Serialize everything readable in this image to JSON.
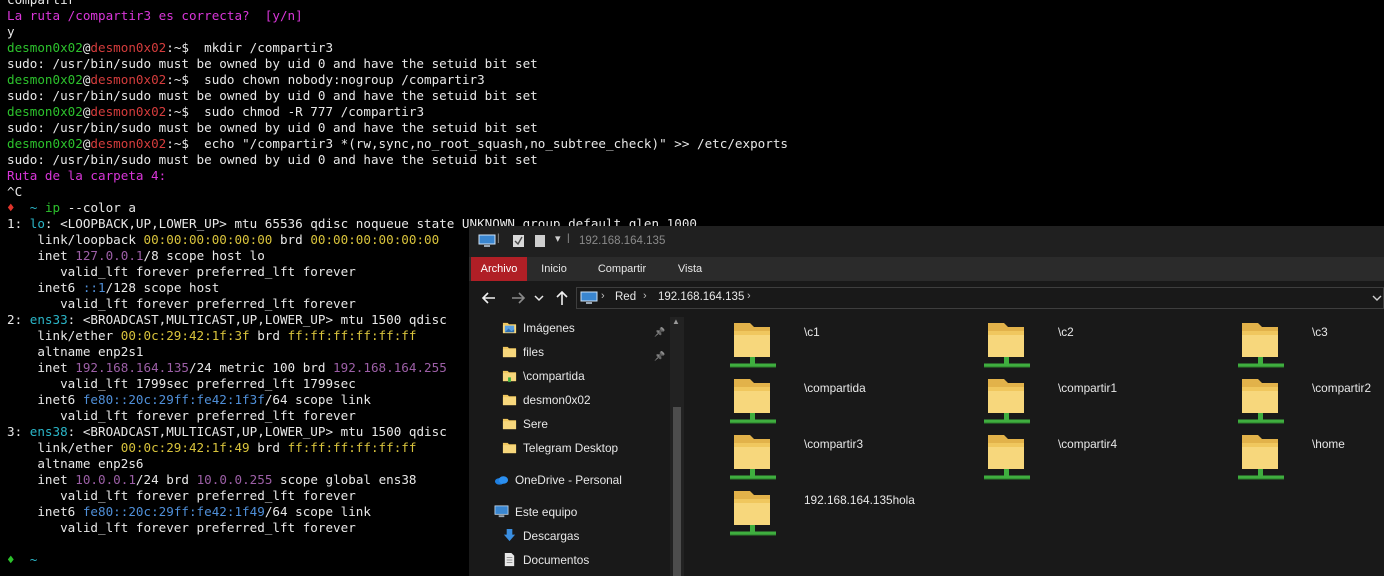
{
  "terminal": {
    "lines": [
      [
        [
          "c-plain",
          "compartir"
        ]
      ],
      [
        [
          "c-mag",
          "La ruta /compartir3 es correcta?  [y/n]"
        ]
      ],
      [
        [
          "c-plain",
          "y"
        ]
      ],
      [
        [
          "c-user",
          "desmon0x02"
        ],
        [
          "c-plain",
          "@"
        ],
        [
          "c-host",
          "desmon0x02"
        ],
        [
          "c-plain",
          ":~$  mkdir /compartir3"
        ]
      ],
      [
        [
          "c-plain",
          "sudo: /usr/bin/sudo must be owned by uid 0 and have the setuid bit set"
        ]
      ],
      [
        [
          "c-user",
          "desmon0x02"
        ],
        [
          "c-plain",
          "@"
        ],
        [
          "c-host",
          "desmon0x02"
        ],
        [
          "c-plain",
          ":~$  sudo chown nobody:nogroup /compartir3"
        ]
      ],
      [
        [
          "c-plain",
          "sudo: /usr/bin/sudo must be owned by uid 0 and have the setuid bit set"
        ]
      ],
      [
        [
          "c-user",
          "desmon0x02"
        ],
        [
          "c-plain",
          "@"
        ],
        [
          "c-host",
          "desmon0x02"
        ],
        [
          "c-plain",
          ":~$  sudo chmod -R 777 /compartir3"
        ]
      ],
      [
        [
          "c-plain",
          "sudo: /usr/bin/sudo must be owned by uid 0 and have the setuid bit set"
        ]
      ],
      [
        [
          "c-user",
          "desmon0x02"
        ],
        [
          "c-plain",
          "@"
        ],
        [
          "c-host",
          "desmon0x02"
        ],
        [
          "c-plain",
          ":~$  echo \"/compartir3 *(rw,sync,no_root_squash,no_subtree_check)\" >> /etc/exports"
        ]
      ],
      [
        [
          "c-plain",
          "sudo: /usr/bin/sudo must be owned by uid 0 and have the setuid bit set"
        ]
      ],
      [
        [
          "c-mag",
          "Ruta de la carpeta 4:"
        ]
      ],
      [
        [
          "c-plain",
          "^C"
        ]
      ],
      [
        [
          "c-red",
          "♦"
        ],
        [
          "c-plain",
          "  "
        ],
        [
          "c-cyan",
          "~"
        ],
        [
          "c-plain",
          " "
        ],
        [
          "c-green",
          "ip"
        ],
        [
          "c-plain",
          " --color a"
        ]
      ],
      [
        [
          "c-plain",
          "1: "
        ],
        [
          "c-cyan",
          "lo"
        ],
        [
          "c-plain",
          ": <LOOPBACK,UP,LOWER_UP> mtu 65536 qdisc noqueue state UNKNOWN group default qlen 1000"
        ]
      ],
      [
        [
          "c-plain",
          "    link/loopback "
        ],
        [
          "c-yellow",
          "00:00:00:00:00:00"
        ],
        [
          "c-plain",
          " brd "
        ],
        [
          "c-yellow",
          "00:00:00:00:00:00"
        ]
      ],
      [
        [
          "c-plain",
          "    inet "
        ],
        [
          "c-purple",
          "127.0.0.1"
        ],
        [
          "c-plain",
          "/8 scope host lo"
        ]
      ],
      [
        [
          "c-plain",
          "       valid_lft forever preferred_lft forever"
        ]
      ],
      [
        [
          "c-plain",
          "    inet6 "
        ],
        [
          "c-blue",
          "::1"
        ],
        [
          "c-plain",
          "/128 scope host"
        ]
      ],
      [
        [
          "c-plain",
          "       valid_lft forever preferred_lft forever"
        ]
      ],
      [
        [
          "c-plain",
          "2: "
        ],
        [
          "c-cyan",
          "ens33"
        ],
        [
          "c-plain",
          ": <BROADCAST,MULTICAST,UP,LOWER_UP> mtu 1500 qdisc"
        ]
      ],
      [
        [
          "c-plain",
          "    link/ether "
        ],
        [
          "c-yellow",
          "00:0c:29:42:1f:3f"
        ],
        [
          "c-plain",
          " brd "
        ],
        [
          "c-yellow",
          "ff:ff:ff:ff:ff:ff"
        ]
      ],
      [
        [
          "c-plain",
          "    altname enp2s1"
        ]
      ],
      [
        [
          "c-plain",
          "    inet "
        ],
        [
          "c-purple",
          "192.168.164.135"
        ],
        [
          "c-plain",
          "/24 metric 100 brd "
        ],
        [
          "c-purple",
          "192.168.164.255"
        ]
      ],
      [
        [
          "c-plain",
          "       valid_lft 1799sec preferred_lft 1799sec"
        ]
      ],
      [
        [
          "c-plain",
          "    inet6 "
        ],
        [
          "c-blue",
          "fe80::20c:29ff:fe42:1f3f"
        ],
        [
          "c-plain",
          "/64 scope link"
        ]
      ],
      [
        [
          "c-plain",
          "       valid_lft forever preferred_lft forever"
        ]
      ],
      [
        [
          "c-plain",
          "3: "
        ],
        [
          "c-cyan",
          "ens38"
        ],
        [
          "c-plain",
          ": <BROADCAST,MULTICAST,UP,LOWER_UP> mtu 1500 qdisc"
        ]
      ],
      [
        [
          "c-plain",
          "    link/ether "
        ],
        [
          "c-yellow",
          "00:0c:29:42:1f:49"
        ],
        [
          "c-plain",
          " brd "
        ],
        [
          "c-yellow",
          "ff:ff:ff:ff:ff:ff"
        ]
      ],
      [
        [
          "c-plain",
          "    altname enp2s6"
        ]
      ],
      [
        [
          "c-plain",
          "    inet "
        ],
        [
          "c-purple",
          "10.0.0.1"
        ],
        [
          "c-plain",
          "/24 brd "
        ],
        [
          "c-purple",
          "10.0.0.255"
        ],
        [
          "c-plain",
          " scope global ens38"
        ]
      ],
      [
        [
          "c-plain",
          "       valid_lft forever preferred_lft forever"
        ]
      ],
      [
        [
          "c-plain",
          "    inet6 "
        ],
        [
          "c-blue",
          "fe80::20c:29ff:fe42:1f49"
        ],
        [
          "c-plain",
          "/64 scope link"
        ]
      ],
      [
        [
          "c-plain",
          "       valid_lft forever preferred_lft forever"
        ]
      ],
      [],
      [
        [
          "c-green",
          "♦"
        ],
        [
          "c-plain",
          "  "
        ],
        [
          "c-cyan",
          "~"
        ]
      ]
    ]
  },
  "explorer": {
    "title": "192.168.164.135",
    "ribbon_tabs": {
      "archivo": "Archivo",
      "inicio": "Inicio",
      "compartir": "Compartir",
      "vista": "Vista"
    },
    "address": {
      "crumb_network": "Red",
      "crumb_host": "192.168.164.135"
    },
    "nav_items": [
      {
        "label": "Imágenes",
        "icon": "pictures-folder-icon",
        "pinned": true
      },
      {
        "label": "files",
        "icon": "folder-icon",
        "pinned": true
      },
      {
        "label": "\\compartida",
        "icon": "network-folder-icon",
        "pinned": false
      },
      {
        "label": "desmon0x02",
        "icon": "folder-icon",
        "pinned": false
      },
      {
        "label": "Sere",
        "icon": "folder-icon",
        "pinned": false
      },
      {
        "label": "Telegram Desktop",
        "icon": "folder-icon",
        "pinned": false
      },
      {
        "label": "OneDrive - Personal",
        "icon": "onedrive-icon",
        "pinned": false
      },
      {
        "label": "Este equipo",
        "icon": "this-pc-icon",
        "pinned": false
      },
      {
        "label": "Descargas",
        "icon": "downloads-icon",
        "pinned": false
      },
      {
        "label": "Documentos",
        "icon": "documents-icon",
        "pinned": false
      }
    ],
    "shares": [
      "\\c1",
      "\\c2",
      "\\c3",
      "\\compartida",
      "\\compartir1",
      "\\compartir2",
      "\\compartir3",
      "\\compartir4",
      "\\home",
      "192.168.164.135hola"
    ]
  },
  "colors": {
    "archivo_tab": "#b01f26",
    "folder": "#f0c75e",
    "share_pipe": "#3fae3f"
  }
}
